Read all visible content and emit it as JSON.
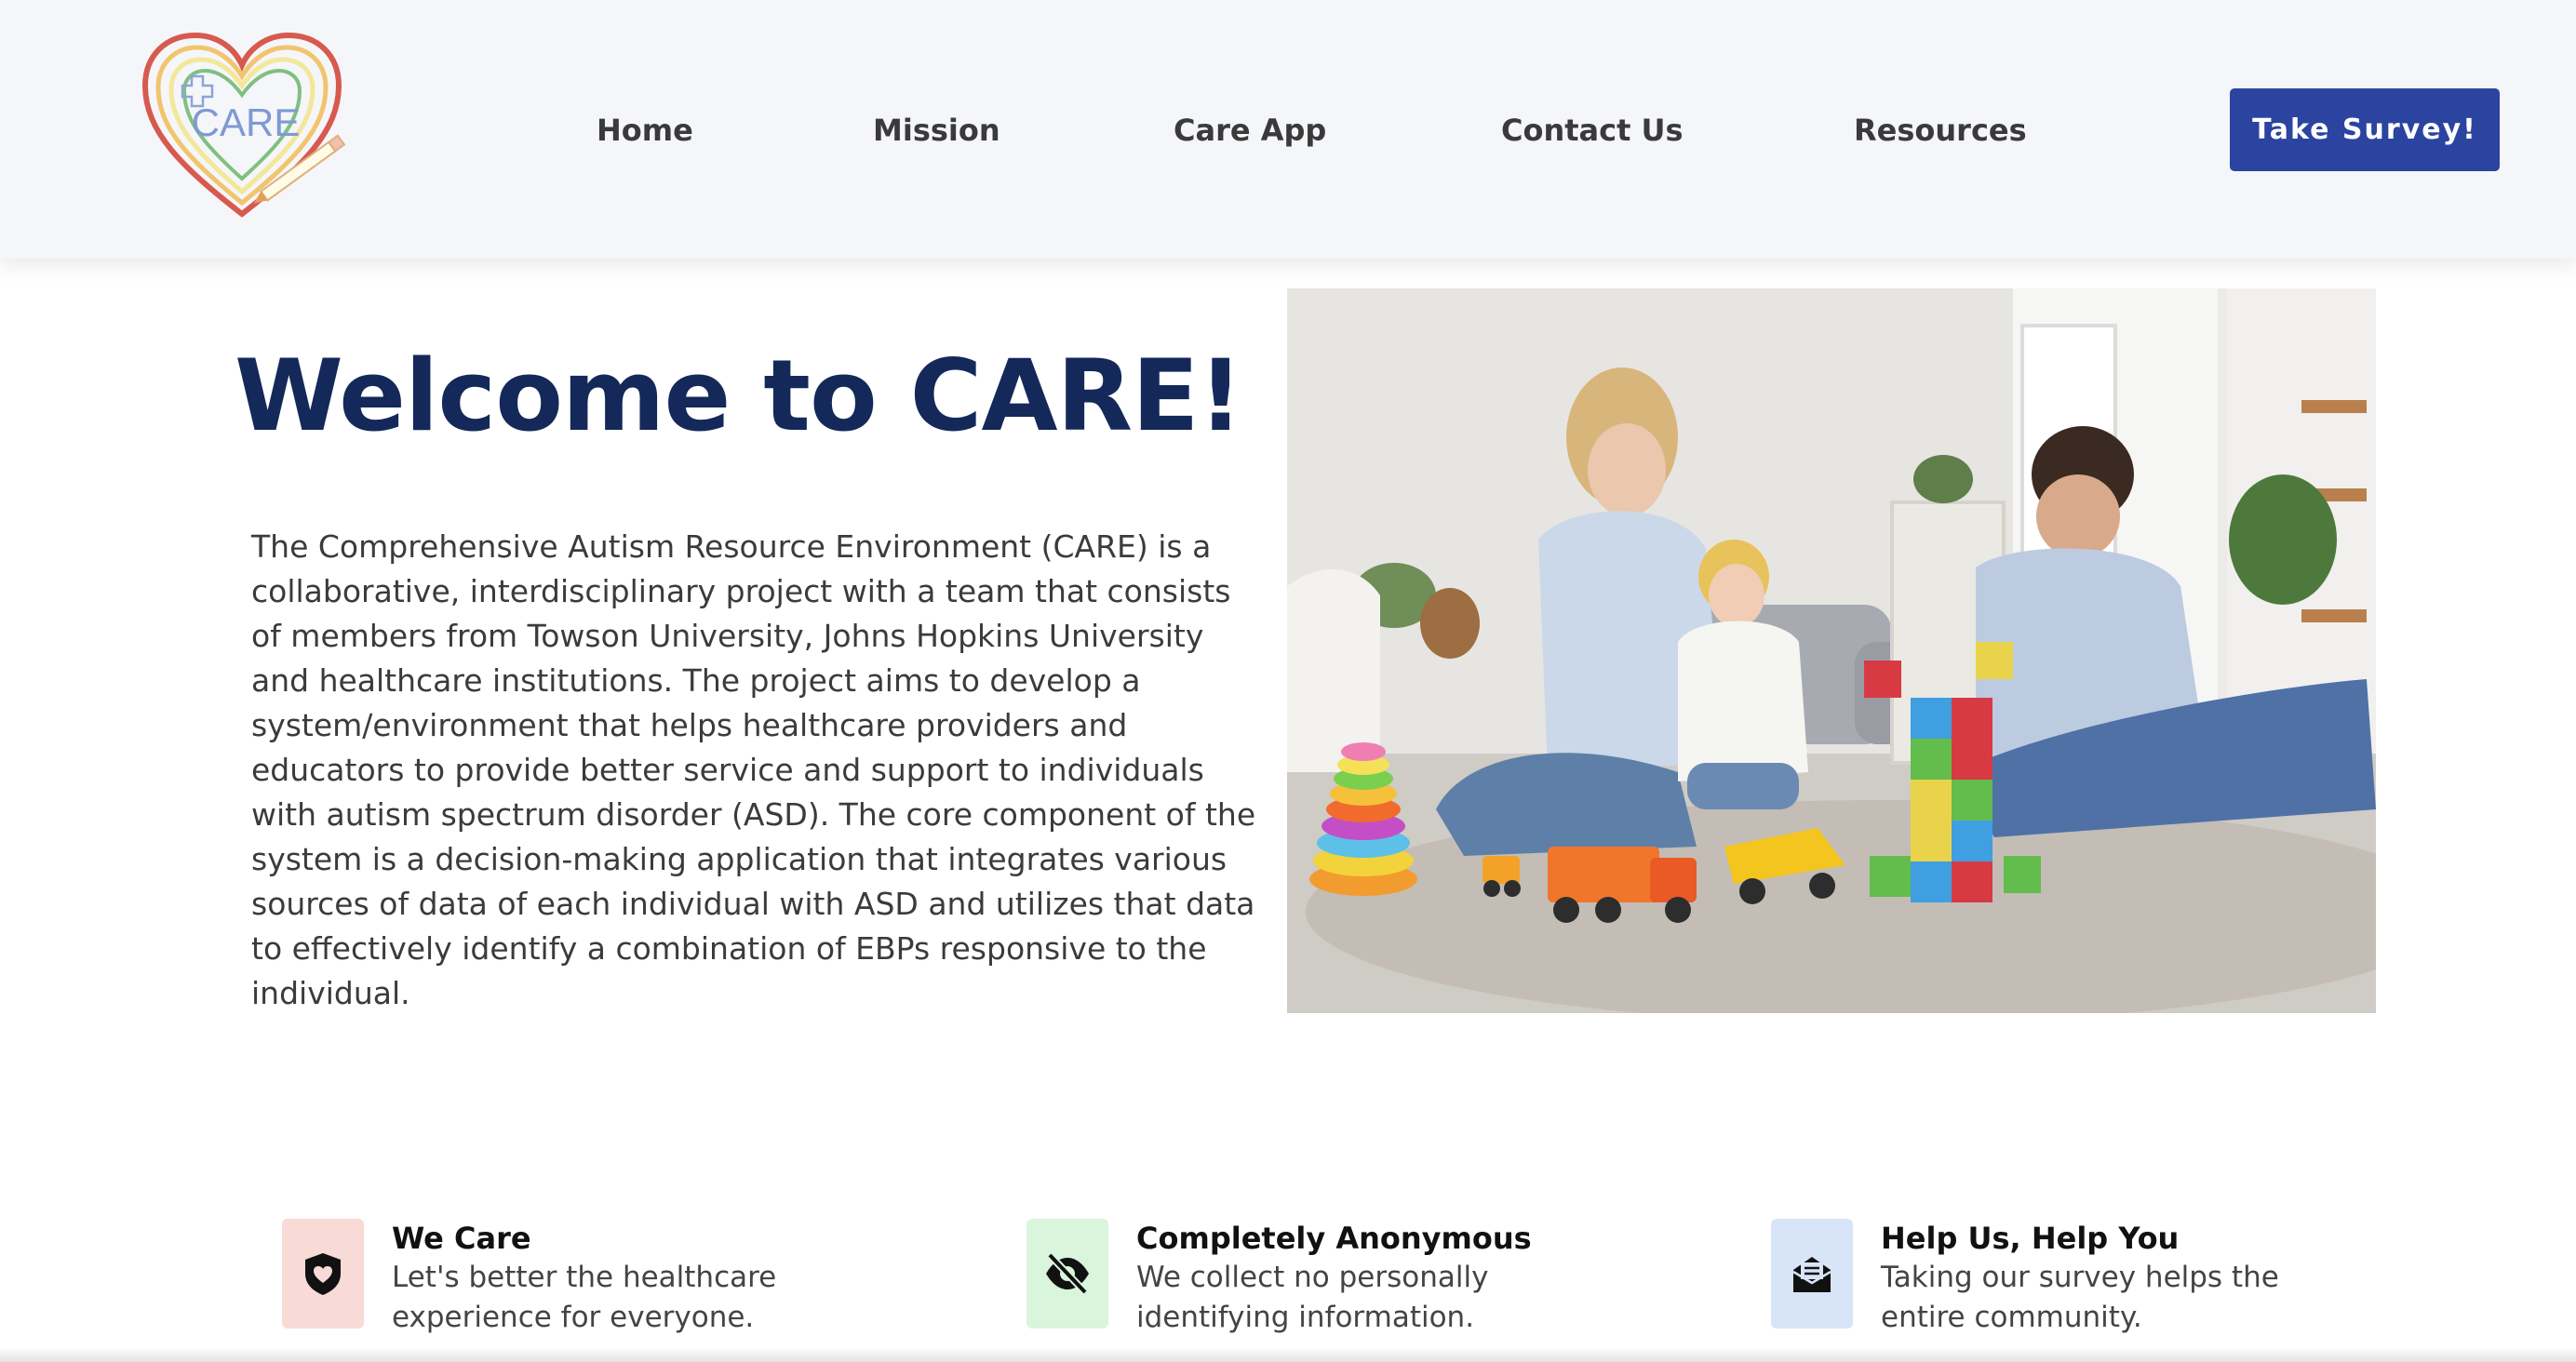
{
  "header": {
    "logo_text": "CARE",
    "nav": [
      "Home",
      "Mission",
      "Care App",
      "Contact Us",
      "Resources"
    ],
    "cta_label": "Take Survey!"
  },
  "hero": {
    "title": "Welcome to CARE!",
    "description": "The Comprehensive Autism Resource Environment (CARE) is a collaborative, interdisciplinary project with a team that consists of members from Towson University, Johns Hopkins University and healthcare institutions. The project aims to develop a system/environment that helps healthcare providers and educators to provide better service and support to individuals with autism spectrum disorder (ASD). The core component of the system is a decision-making application that integrates various sources of data of each individual with ASD and utilizes that data to effectively identify a combination of EBPs responsive to the individual."
  },
  "features": [
    {
      "title": "We Care",
      "text": "Let's better the healthcare experience for everyone.",
      "icon": "heart-shield-icon",
      "bg": "#f8dad6"
    },
    {
      "title": "Completely Anonymous",
      "text": "We collect no personally identifying information.",
      "icon": "eye-slash-icon",
      "bg": "#d9f5dc"
    },
    {
      "title": "Help Us, Help You",
      "text": "Taking our survey helps the entire community.",
      "icon": "envelope-open-icon",
      "bg": "#d8e4f8"
    }
  ],
  "colors": {
    "header_bg": "#f5f6f9",
    "accent": "#2b44a0",
    "title": "#14295a",
    "text": "#3b3b3b"
  }
}
